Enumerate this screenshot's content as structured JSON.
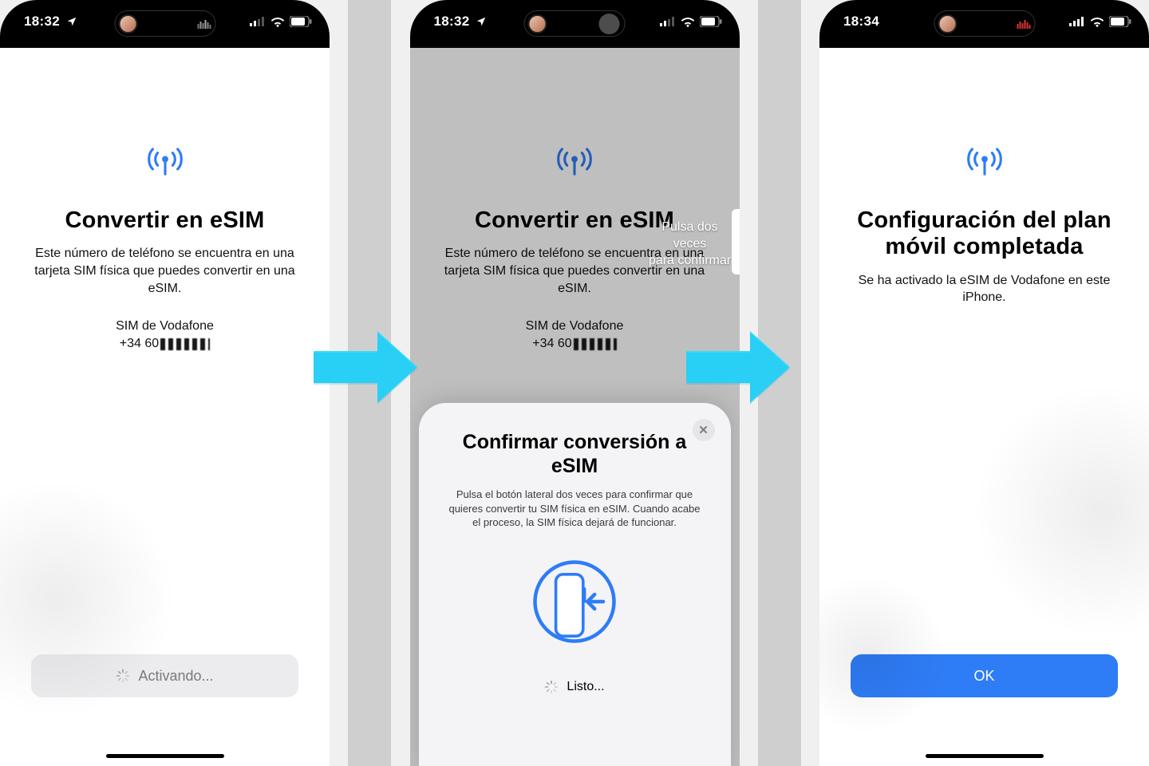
{
  "screen1": {
    "time": "18:32",
    "title": "Convertir en eSIM",
    "description": "Este número de teléfono se encuentra en una tarjeta SIM física que puedes convertir en una eSIM.",
    "sim_label": "SIM de Vodafone",
    "phone_prefix": "+34 60",
    "activating": "Activando..."
  },
  "screen2": {
    "time": "18:32",
    "title": "Convertir en eSIM",
    "description": "Este número de teléfono se encuentra en una tarjeta SIM física que puedes convertir en una eSIM.",
    "sim_label": "SIM de Vodafone",
    "phone_prefix": "+34 60",
    "side_hint_line1": "Pulsa dos veces",
    "side_hint_line2": "para confirmar",
    "sheet": {
      "title": "Confirmar conversión a eSIM",
      "description": "Pulsa el botón lateral dos veces para confirmar que quieres convertir tu SIM física en eSIM. Cuando acabe el proceso, la SIM física dejará de funcionar.",
      "status": "Listo...",
      "close": "✕"
    }
  },
  "screen3": {
    "time": "18:34",
    "title": "Configuración del plan móvil completada",
    "description": "Se ha activado la eSIM de Vodafone en este iPhone.",
    "ok": "OK"
  }
}
